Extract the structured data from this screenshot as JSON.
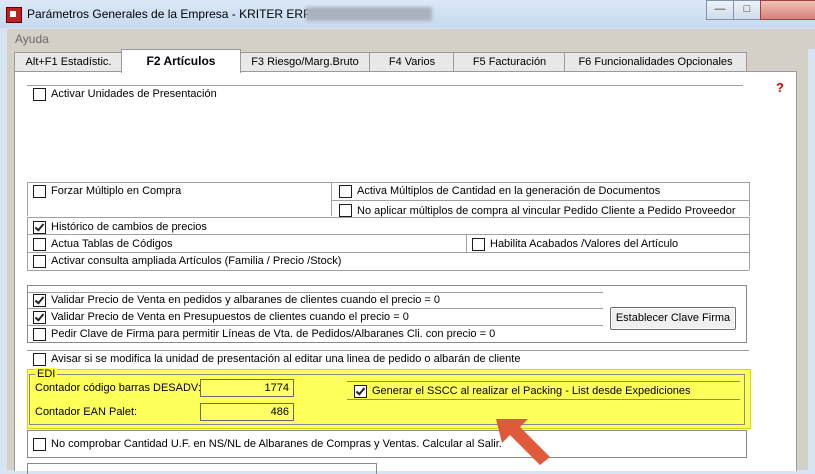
{
  "window": {
    "title": "Parámetros Generales de la Empresa - KRITER ERP -",
    "minimize_glyph": "—",
    "maximize_glyph": "□"
  },
  "menu": {
    "help_label": "Ayuda"
  },
  "tabs": [
    {
      "label": "Alt+F1 Estadístic.",
      "active": false
    },
    {
      "label": "F2 Artículos",
      "active": true
    },
    {
      "label": "F3 Riesgo/Marg.Bruto",
      "active": false
    },
    {
      "label": "F4 Varios",
      "active": false
    },
    {
      "label": "F5 Facturación",
      "active": false
    },
    {
      "label": "F6 Funcionalidades Opcionales",
      "active": false
    }
  ],
  "options": {
    "unidades_presentacion": {
      "label": "Activar Unidades de Presentación",
      "checked": false
    },
    "forzar_multiplo": {
      "label": "Forzar Múltiplo en Compra",
      "checked": false
    },
    "activa_multiplos": {
      "label": "Activa Múltiplos de Cantidad en la generación de  Documentos",
      "checked": false
    },
    "no_aplicar_multiplos": {
      "label": "No aplicar múltiplos de compra al vincular Pedido Cliente a Pedido Proveedor",
      "checked": false
    },
    "historico_precios": {
      "label": "Histórico de cambios de precios",
      "checked": true
    },
    "actua_tablas": {
      "label": "Actua Tablas de Códigos",
      "checked": false
    },
    "habilita_acabados": {
      "label": "Habilita Acabados /Valores del Artículo",
      "checked": false
    },
    "consulta_ampliada": {
      "label": "Activar consulta ampliada Artículos (Familia / Precio /Stock)",
      "checked": false
    },
    "validar_precio_pedidos": {
      "label": "Validar Precio de Venta en pedidos y albaranes de clientes cuando el precio = 0",
      "checked": true
    },
    "validar_precio_presupuestos": {
      "label": "Validar Precio de Venta en Presupuestos de clientes cuando el precio = 0",
      "checked": true
    },
    "pedir_clave_firma": {
      "label": "Pedir Clave de Firma para permitir Líneas de Vta. de Pedidos/Albaranes Cli. con precio = 0",
      "checked": false
    },
    "avisar_unidad": {
      "label": "Avisar si se modifica la unidad de presentación al editar una linea de pedido o albarán de cliente",
      "checked": false
    },
    "generar_sscc": {
      "label": "Generar el SSCC al realizar el Packing - List desde Expediciones",
      "checked": true
    },
    "no_comprobar_uf": {
      "label": "No comprobar Cantidad U.F. en NS/NL de Albaranes de Compras y Ventas. Calcular al Salir.",
      "checked": false
    }
  },
  "buttons": {
    "establecer_clave": "Establecer Clave Firma"
  },
  "edi": {
    "legend": "EDI",
    "desadv_label": "Contador código barras DESADV:",
    "desadv_value": "1774",
    "ean_label": "Contador EAN Palet:",
    "ean_value": "486"
  },
  "icons": {
    "help": "help-icon",
    "app": "kriter-app-icon",
    "arrow": "annotation-arrow"
  },
  "colors": {
    "highlight": "#ffff3c",
    "arrow": "#e05a3a",
    "input_bg": "#ffff66"
  }
}
